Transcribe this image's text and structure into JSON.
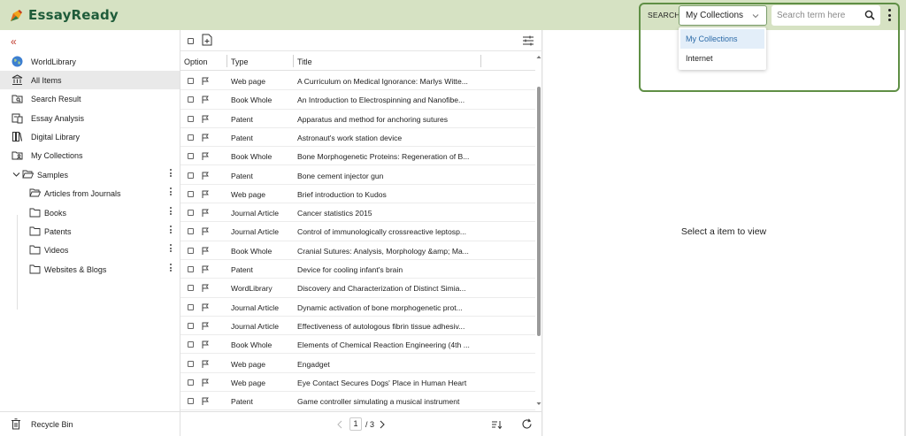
{
  "app": {
    "title": "EssayReady"
  },
  "search": {
    "label": "SEARCH",
    "scope_value": "My Collections",
    "placeholder": "Search term here",
    "dropdown_options": [
      "My Collections",
      "Internet"
    ]
  },
  "sidebar": {
    "nav": [
      {
        "label": "WorldLibrary",
        "icon": "globe-icon"
      },
      {
        "label": "All Items",
        "icon": "institution-icon",
        "selected": true
      },
      {
        "label": "Search Result",
        "icon": "folder-search-icon"
      },
      {
        "label": "Essay Analysis",
        "icon": "analysis-icon"
      },
      {
        "label": "Digital Library",
        "icon": "books-icon"
      },
      {
        "label": "My Collections",
        "icon": "folder-user-icon"
      }
    ],
    "tree": {
      "root": "Samples",
      "children": [
        "Articles from Journals",
        "Books",
        "Patents",
        "Videos",
        "Websites & Blogs"
      ]
    },
    "recycle_bin": "Recycle Bin"
  },
  "list": {
    "columns": {
      "option": "Option",
      "type": "Type",
      "title": "Title"
    },
    "rows": [
      {
        "type": "Web page",
        "title": "A Curriculum on Medical Ignorance: Marlys Witte..."
      },
      {
        "type": "Book Whole",
        "title": "An Introduction to Electrospinning and Nanofibe..."
      },
      {
        "type": "Patent",
        "title": "Apparatus and method for anchoring sutures"
      },
      {
        "type": "Patent",
        "title": "Astronaut's work station device"
      },
      {
        "type": "Book Whole",
        "title": "Bone Morphogenetic Proteins: Regeneration of B..."
      },
      {
        "type": "Patent",
        "title": "Bone cement injector gun"
      },
      {
        "type": "Web page",
        "title": "Brief introduction to Kudos"
      },
      {
        "type": "Journal Article",
        "title": "Cancer statistics 2015"
      },
      {
        "type": "Journal Article",
        "title": "Control of immunologically crossreactive leptosp..."
      },
      {
        "type": "Book Whole",
        "title": "Cranial Sutures: Analysis, Morphology &amp; Ma..."
      },
      {
        "type": "Patent",
        "title": "Device for cooling infant's brain"
      },
      {
        "type": "WordLibrary",
        "title": "Discovery and Characterization of Distinct Simia..."
      },
      {
        "type": "Journal Article",
        "title": "Dynamic activation of bone morphogenetic prot..."
      },
      {
        "type": "Journal Article",
        "title": "Effectiveness of autologous fibrin tissue adhesiv..."
      },
      {
        "type": "Book Whole",
        "title": "Elements of Chemical Reaction Engineering (4th ..."
      },
      {
        "type": "Web page",
        "title": "Engadget"
      },
      {
        "type": "Web page",
        "title": "Eye Contact Secures Dogs' Place in Human Heart"
      },
      {
        "type": "Patent",
        "title": "Game controller simulating a musical instrument"
      }
    ],
    "pagination": {
      "current": "1",
      "total": "/ 3"
    }
  },
  "detail": {
    "empty_message": "Select a item to view"
  }
}
